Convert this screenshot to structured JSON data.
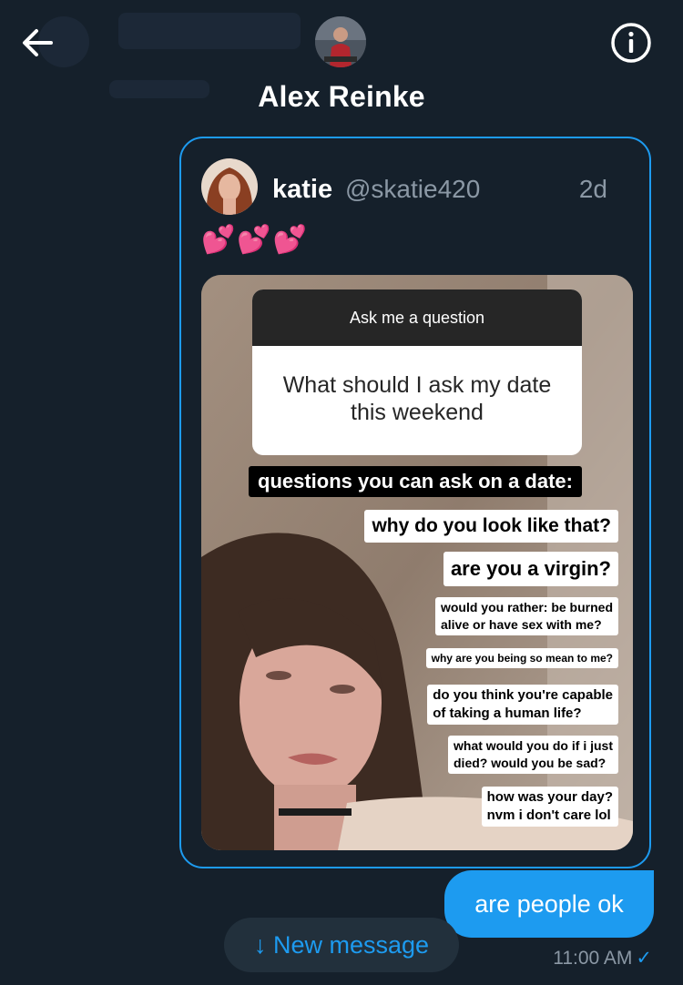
{
  "header": {
    "title": "Alex Reinke",
    "back_icon": "arrow-left-icon",
    "info_icon": "info-icon"
  },
  "quoted_tweet": {
    "name": "katie",
    "handle": "@skatie420",
    "time": "2d",
    "text": "💕💕💕",
    "story": {
      "question_header": "Ask me a question",
      "question": "What should I ask my date this weekend",
      "answers_title": "questions you can ask on a date:",
      "answers": [
        "why do you look like that?",
        "are you a virgin?",
        "would you rather: be burned\nalive or have sex with me?",
        "why are you being so mean to me?",
        "do you think you're capable\nof taking a human life?",
        "what would you do if i just\ndied? would you be sad?",
        "how was your day?\nnvm i don't care lol"
      ]
    }
  },
  "message": {
    "text": "are people ok",
    "time": "11:00 AM",
    "status_icon": "check-icon"
  },
  "new_message_pill": {
    "label": "↓ New message"
  },
  "colors": {
    "background": "#15202b",
    "accent": "#1d9bf0",
    "muted_text": "#8b98a5",
    "pill_bg": "#22303c"
  }
}
